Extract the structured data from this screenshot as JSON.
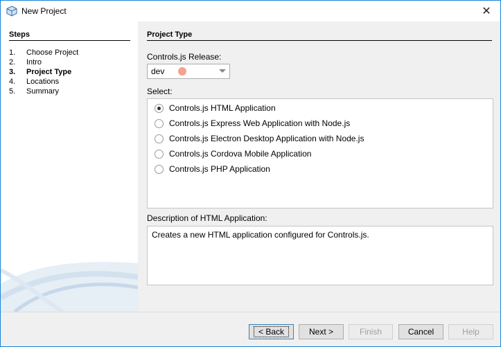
{
  "window": {
    "title": "New Project",
    "close_label": "✕"
  },
  "steps": {
    "title": "Steps",
    "items": [
      {
        "num": "1.",
        "label": "Choose Project"
      },
      {
        "num": "2.",
        "label": "Intro"
      },
      {
        "num": "3.",
        "label": "Project Type"
      },
      {
        "num": "4.",
        "label": "Locations"
      },
      {
        "num": "5.",
        "label": "Summary"
      }
    ]
  },
  "main": {
    "section_title": "Project Type",
    "release_label": "Controls.js Release:",
    "release_value": "dev",
    "select_label": "Select:",
    "options": [
      "Controls.js HTML Application",
      "Controls.js Express Web Application with Node.js",
      "Controls.js Electron Desktop Application with Node.js",
      "Controls.js Cordova Mobile Application",
      "Controls.js PHP Application"
    ],
    "description_label": "Description of HTML Application:",
    "description_text": "Creates a new HTML application configured for Controls.js."
  },
  "buttons": {
    "back": "< Back",
    "next": "Next >",
    "finish": "Finish",
    "cancel": "Cancel",
    "help": "Help"
  },
  "icons": {
    "app": "netbeans-cube-icon",
    "close": "close-icon",
    "dropdown": "chevron-down-icon"
  },
  "colors": {
    "accent": "#1883d7",
    "release_dot": "#f5a28e"
  }
}
